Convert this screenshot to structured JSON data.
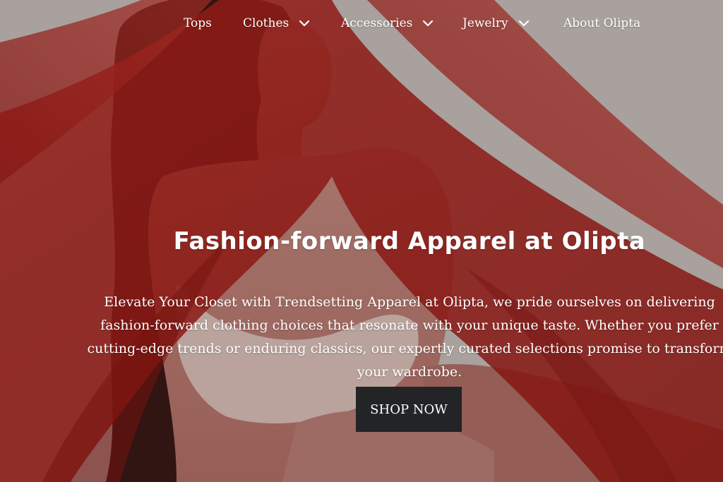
{
  "nav": {
    "items": [
      {
        "label": "Tops",
        "has_dropdown": false
      },
      {
        "label": "Clothes",
        "has_dropdown": true
      },
      {
        "label": "Accessories",
        "has_dropdown": true
      },
      {
        "label": "Jewelry",
        "has_dropdown": true
      },
      {
        "label": "About Olipta",
        "has_dropdown": false
      }
    ],
    "dropdown_icon": "chevron-down-icon"
  },
  "hero": {
    "headline": "Fashion-forward Apparel at Olipta",
    "description": "Elevate Your Closet with Trendsetting Apparel at Olipta, we pride ourselves on delivering fashion-forward clothing choices that resonate with your unique taste. Whether you prefer cutting-edge trends or enduring classics, our expertly curated selections promise to transform your wardrobe.",
    "cta_label": "SHOP NOW"
  },
  "colors": {
    "button_bg": "#222426",
    "text": "#ffffff",
    "fabric_red": "#b8241f",
    "backdrop": "#cfc7c2"
  }
}
